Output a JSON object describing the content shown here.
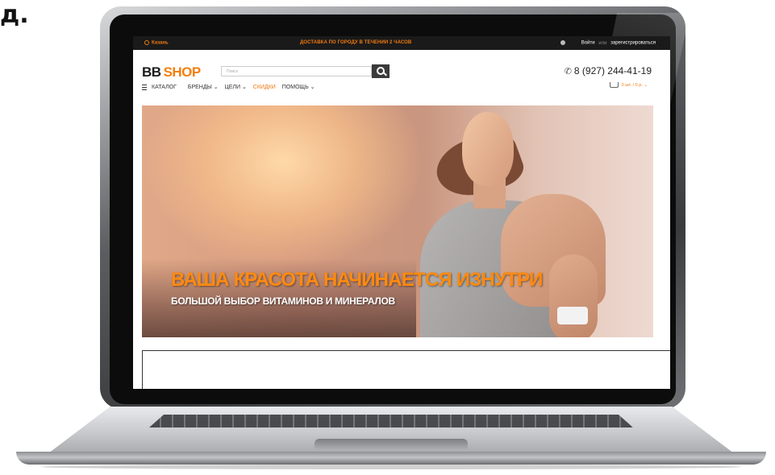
{
  "page": {
    "corner_text": "д."
  },
  "site": {
    "topbar": {
      "city": "Казань",
      "delivery": "ДОСТАВКА ПО ГОРОДУ В ТЕЧЕНИИ 2 ЧАСОВ",
      "login": "Войти",
      "or": "или",
      "register": "зарегистрироваться"
    },
    "header": {
      "logo_bb": "BB",
      "logo_shop": "SHOP",
      "search_placeholder": "Поиск",
      "phone": "8 (927) 244-41-19"
    },
    "nav": {
      "catalog": "КАТАЛОГ",
      "brands": "БРЕНДЫ ⌄",
      "goals": "ЦЕЛИ ⌄",
      "sale": "СКИДКИ",
      "help": "ПОМОЩЬ ⌄"
    },
    "cart": {
      "summary": "0 шт. / 0 р.  ⌄"
    },
    "hero": {
      "title": "ВАША КРАСОТА НАЧИНАЕТСЯ ИЗНУТРИ",
      "subtitle": "БОЛЬШОЙ ВЫБОР ВИТАМИНОВ И МИНЕРАЛОВ"
    }
  },
  "colors": {
    "accent": "#f57e0e",
    "topbar_bg": "#1a1a1a"
  }
}
